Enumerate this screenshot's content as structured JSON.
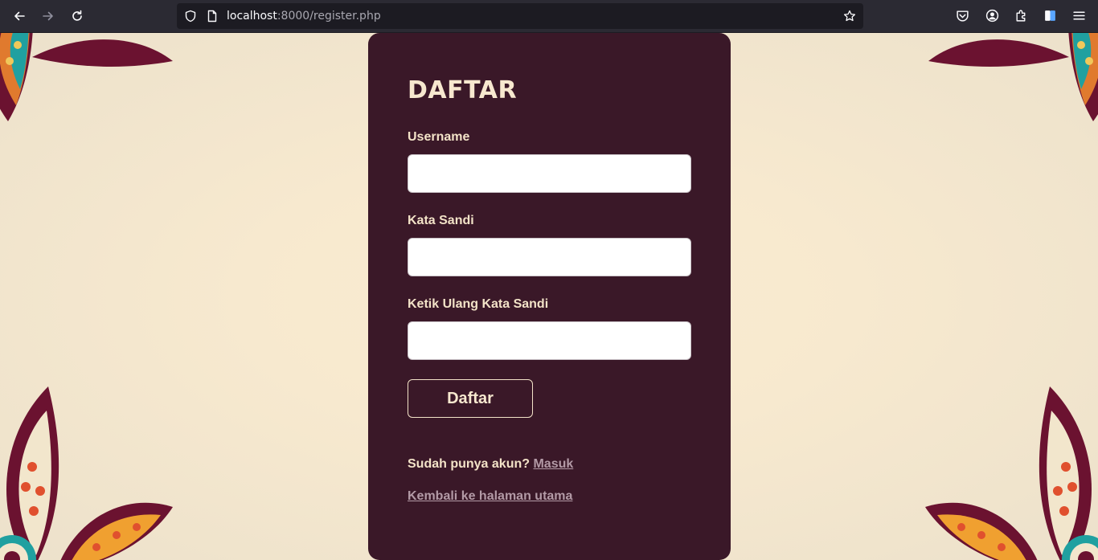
{
  "browser": {
    "url_host": "localhost",
    "url_rest": ":8000/register.php"
  },
  "form": {
    "title": "DAFTAR",
    "username_label": "Username",
    "username_value": "",
    "password_label": "Kata Sandi",
    "password_value": "",
    "confirm_label": "Ketik Ulang Kata Sandi",
    "confirm_value": "",
    "submit_label": "Daftar",
    "login_prompt": "Sudah punya akun?",
    "login_link": "Masuk",
    "home_link": "Kembali ke halaman utama"
  },
  "colors": {
    "card_bg": "#3a1828",
    "text": "#f3e3c8",
    "link": "#b39aa6",
    "page_bg": "#f7e9cf"
  }
}
